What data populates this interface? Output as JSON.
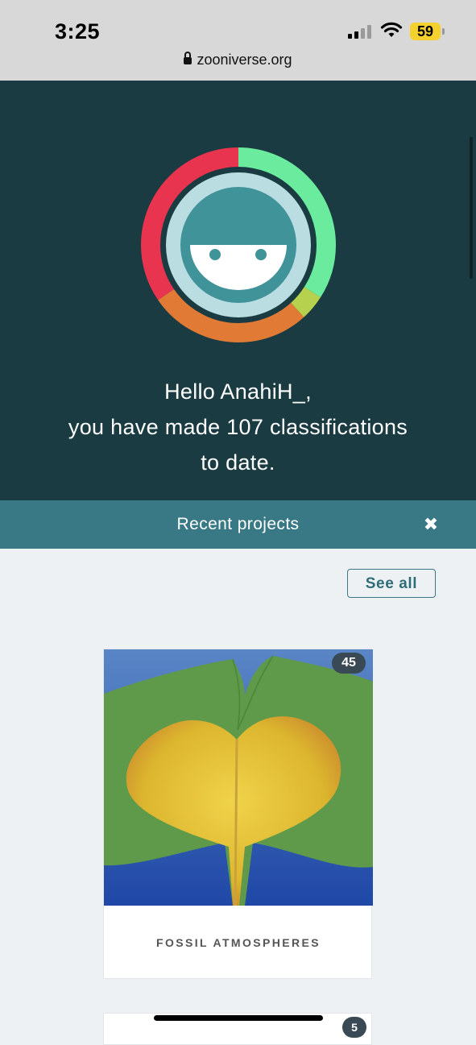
{
  "status_bar": {
    "time": "3:25",
    "battery": "59",
    "url": "zooniverse.org"
  },
  "hero": {
    "greeting_line1": "Hello AnahiH_,",
    "greeting_line2": "you have made 107 classifications",
    "greeting_line3": "to date.",
    "ring_colors": {
      "teal_green": "#6beb9e",
      "lime": "#b6d14d",
      "orange": "#e07a34",
      "red": "#e8344e"
    }
  },
  "recent_projects": {
    "title": "Recent projects",
    "close_icon": "close-icon",
    "see_all_label": "See all",
    "projects": [
      {
        "title": "FOSSIL ATMOSPHERES",
        "count": "45"
      },
      {
        "title": "",
        "count": "5"
      }
    ]
  },
  "colors": {
    "hero_bg": "#1a3b42",
    "bar_bg": "#397985",
    "page_bg": "#edf1f4"
  }
}
